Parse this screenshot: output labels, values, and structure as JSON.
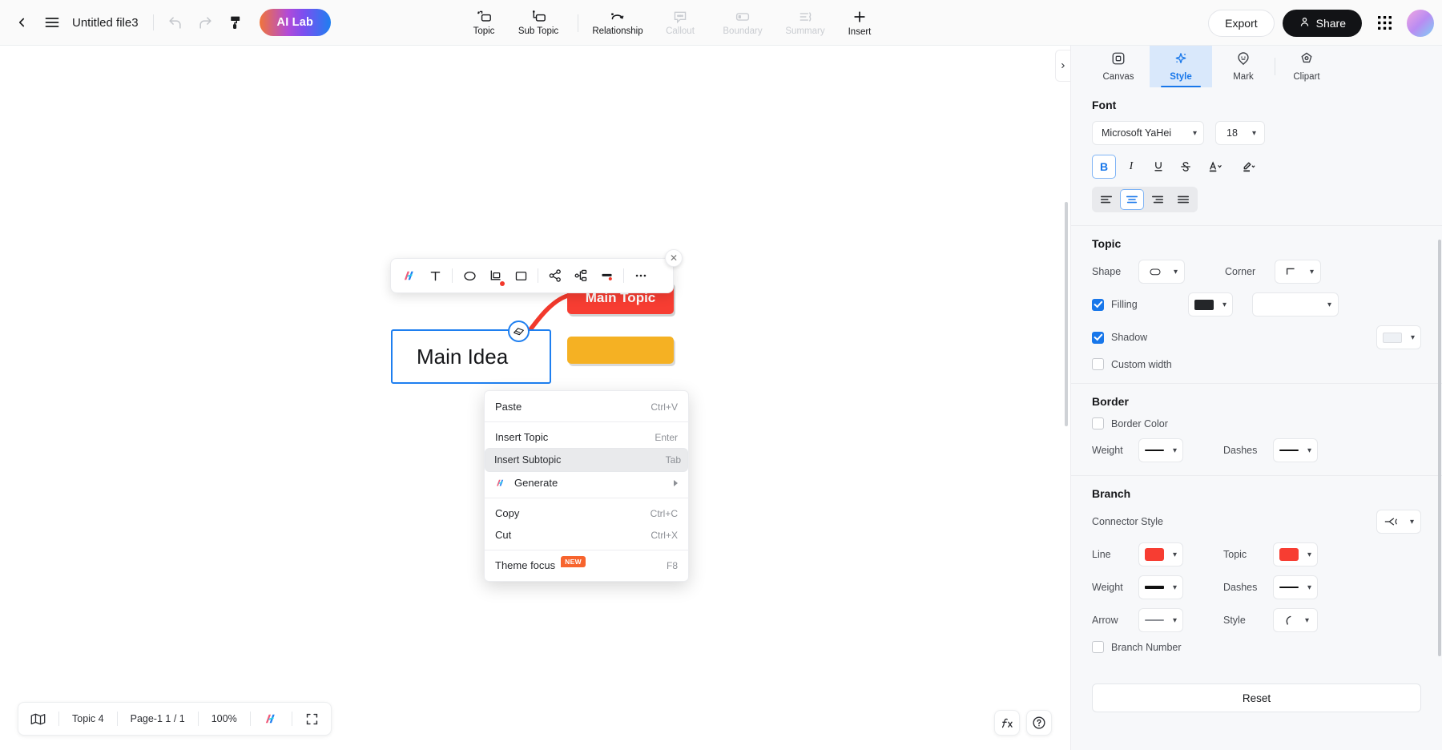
{
  "topbar": {
    "back_icon": "chevron-left-icon",
    "menu_icon": "hamburger-menu-icon",
    "file_title": "Untitled file3",
    "undo_icon": "undo-icon",
    "redo_icon": "redo-icon",
    "format_painter_icon": "format-painter-icon",
    "ai_lab_label": "AI Lab",
    "tools": [
      {
        "label": "Topic",
        "icon": "topic-icon",
        "disabled": false
      },
      {
        "label": "Sub Topic",
        "icon": "subtopic-icon",
        "disabled": false
      },
      {
        "label": "Relationship",
        "icon": "relationship-icon",
        "disabled": false
      },
      {
        "label": "Callout",
        "icon": "callout-icon",
        "disabled": true
      },
      {
        "label": "Boundary",
        "icon": "boundary-icon",
        "disabled": true
      },
      {
        "label": "Summary",
        "icon": "summary-icon",
        "disabled": true
      },
      {
        "label": "Insert",
        "icon": "plus-icon",
        "disabled": false
      }
    ],
    "export_label": "Export",
    "share_label": "Share",
    "apps_grid_icon": "apps-grid-icon",
    "avatar_icon": "user-avatar"
  },
  "view_switch": {
    "items": [
      {
        "name": "mindmap-view",
        "icon": "mindmap-view-icon",
        "active": true
      },
      {
        "name": "outline-view",
        "icon": "outline-view-icon",
        "active": false
      },
      {
        "name": "slide-view",
        "icon": "slide-view-icon",
        "active": false
      }
    ]
  },
  "search": {
    "icon": "search-icon"
  },
  "canvas": {
    "nodes": [
      {
        "name": "main-topic-node",
        "text": "Main Topic",
        "color": "#f73d32"
      },
      {
        "name": "main-idea-node",
        "text": "Main Idea",
        "color": "#ffffff",
        "border": "#1e7ff0"
      },
      {
        "name": "subtopic-node-yellow",
        "text": "",
        "color": "#f5b123"
      }
    ],
    "collapse_badge_icon": "collapse-branch-icon"
  },
  "float_toolbar": {
    "buttons": [
      {
        "name": "ai-generate-button",
        "icon": "ai-sparkle-icon"
      },
      {
        "name": "text-style-button",
        "icon": "text-T-icon"
      },
      {
        "name": "shape-ellipse-button",
        "icon": "ellipse-icon"
      },
      {
        "name": "shape-crop-button",
        "icon": "crop-shape-icon"
      },
      {
        "name": "shape-rect-button",
        "icon": "rectangle-icon"
      },
      {
        "name": "share-node-button",
        "icon": "node-share-icon"
      },
      {
        "name": "branch-layout-button",
        "icon": "branch-layout-icon"
      },
      {
        "name": "line-color-button",
        "icon": "line-color-icon"
      },
      {
        "name": "more-options-button",
        "icon": "ellipsis-icon"
      }
    ],
    "close_icon": "close-icon"
  },
  "context_menu": {
    "items": [
      {
        "label": "Paste",
        "shortcut": "Ctrl+V",
        "icon": "",
        "selected": false,
        "badge": "",
        "submenu": false
      },
      {
        "label": "Insert Topic",
        "shortcut": "Enter",
        "icon": "",
        "selected": false,
        "badge": "",
        "submenu": false
      },
      {
        "label": "Insert Subtopic",
        "shortcut": "Tab",
        "icon": "",
        "selected": true,
        "badge": "",
        "submenu": false
      },
      {
        "label": "Generate",
        "shortcut": "",
        "icon": "ai-sparkle-icon",
        "selected": false,
        "badge": "",
        "submenu": true
      },
      {
        "label": "Copy",
        "shortcut": "Ctrl+C",
        "icon": "",
        "selected": false,
        "badge": "",
        "submenu": false
      },
      {
        "label": "Cut",
        "shortcut": "Ctrl+X",
        "icon": "",
        "selected": false,
        "badge": "",
        "submenu": false
      },
      {
        "label": "Theme focus",
        "shortcut": "F8",
        "icon": "",
        "selected": false,
        "badge": "NEW",
        "submenu": false
      }
    ]
  },
  "bottombar": {
    "map_icon": "map-overview-icon",
    "topic_count": "Topic 4",
    "page_info": "Page-1  1 / 1",
    "zoom": "100%",
    "ai_icon": "ai-sparkle-icon",
    "fullscreen_icon": "fullscreen-icon"
  },
  "bottom_right": {
    "formula_icon": "fx-formula-icon",
    "help_icon": "help-question-icon"
  },
  "panel": {
    "toggle_icon": "chevron-right-icon",
    "tabs": [
      {
        "label": "Canvas",
        "icon": "canvas-icon",
        "active": false
      },
      {
        "label": "Style",
        "icon": "style-sparkle-icon",
        "active": true
      },
      {
        "label": "Mark",
        "icon": "mark-smiley-icon",
        "active": false
      },
      {
        "label": "Clipart",
        "icon": "clipart-star-icon",
        "active": false
      }
    ],
    "font": {
      "title": "Font",
      "family": "Microsoft YaHei",
      "size": "18",
      "bold_label": "B",
      "italic_label": "I",
      "underline_label": "U",
      "strike_label": "S",
      "text_color_label": "A",
      "highlight_label": "highlight-pen-icon",
      "bold_on": true,
      "align_options": [
        "align-left",
        "align-center",
        "align-right",
        "align-justify"
      ],
      "align_active": 1
    },
    "topic": {
      "title": "Topic",
      "shape_label": "Shape",
      "shape_value": "rounded-rect-shape",
      "corner_label": "Corner",
      "corner_value": "sharp-corner",
      "filling_label": "Filling",
      "filling_checked": true,
      "filling_color": "#242629",
      "filling_secondary": "#ffffff",
      "shadow_label": "Shadow",
      "shadow_checked": true,
      "shadow_color": "#e7eaee",
      "custom_width_label": "Custom width",
      "custom_width_checked": false
    },
    "border": {
      "title": "Border",
      "border_color_label": "Border Color",
      "border_color_checked": false,
      "weight_label": "Weight",
      "weight_value": "thin-line",
      "dashes_label": "Dashes",
      "dashes_value": "solid-line"
    },
    "branch": {
      "title": "Branch",
      "connector_style_label": "Connector Style",
      "connector_style_value": "fork-connector",
      "line_label": "Line",
      "line_color": "#f73d32",
      "topic_label": "Topic",
      "topic_color": "#f73d32",
      "weight_label": "Weight",
      "weight_value": "thick-line",
      "dashes_label": "Dashes",
      "dashes_value": "solid-line",
      "arrow_label": "Arrow",
      "arrow_value": "no-arrow",
      "style_label": "Style",
      "style_value": "curve-style",
      "branch_number_label": "Branch Number",
      "branch_number_checked": false
    },
    "reset_label": "Reset"
  }
}
